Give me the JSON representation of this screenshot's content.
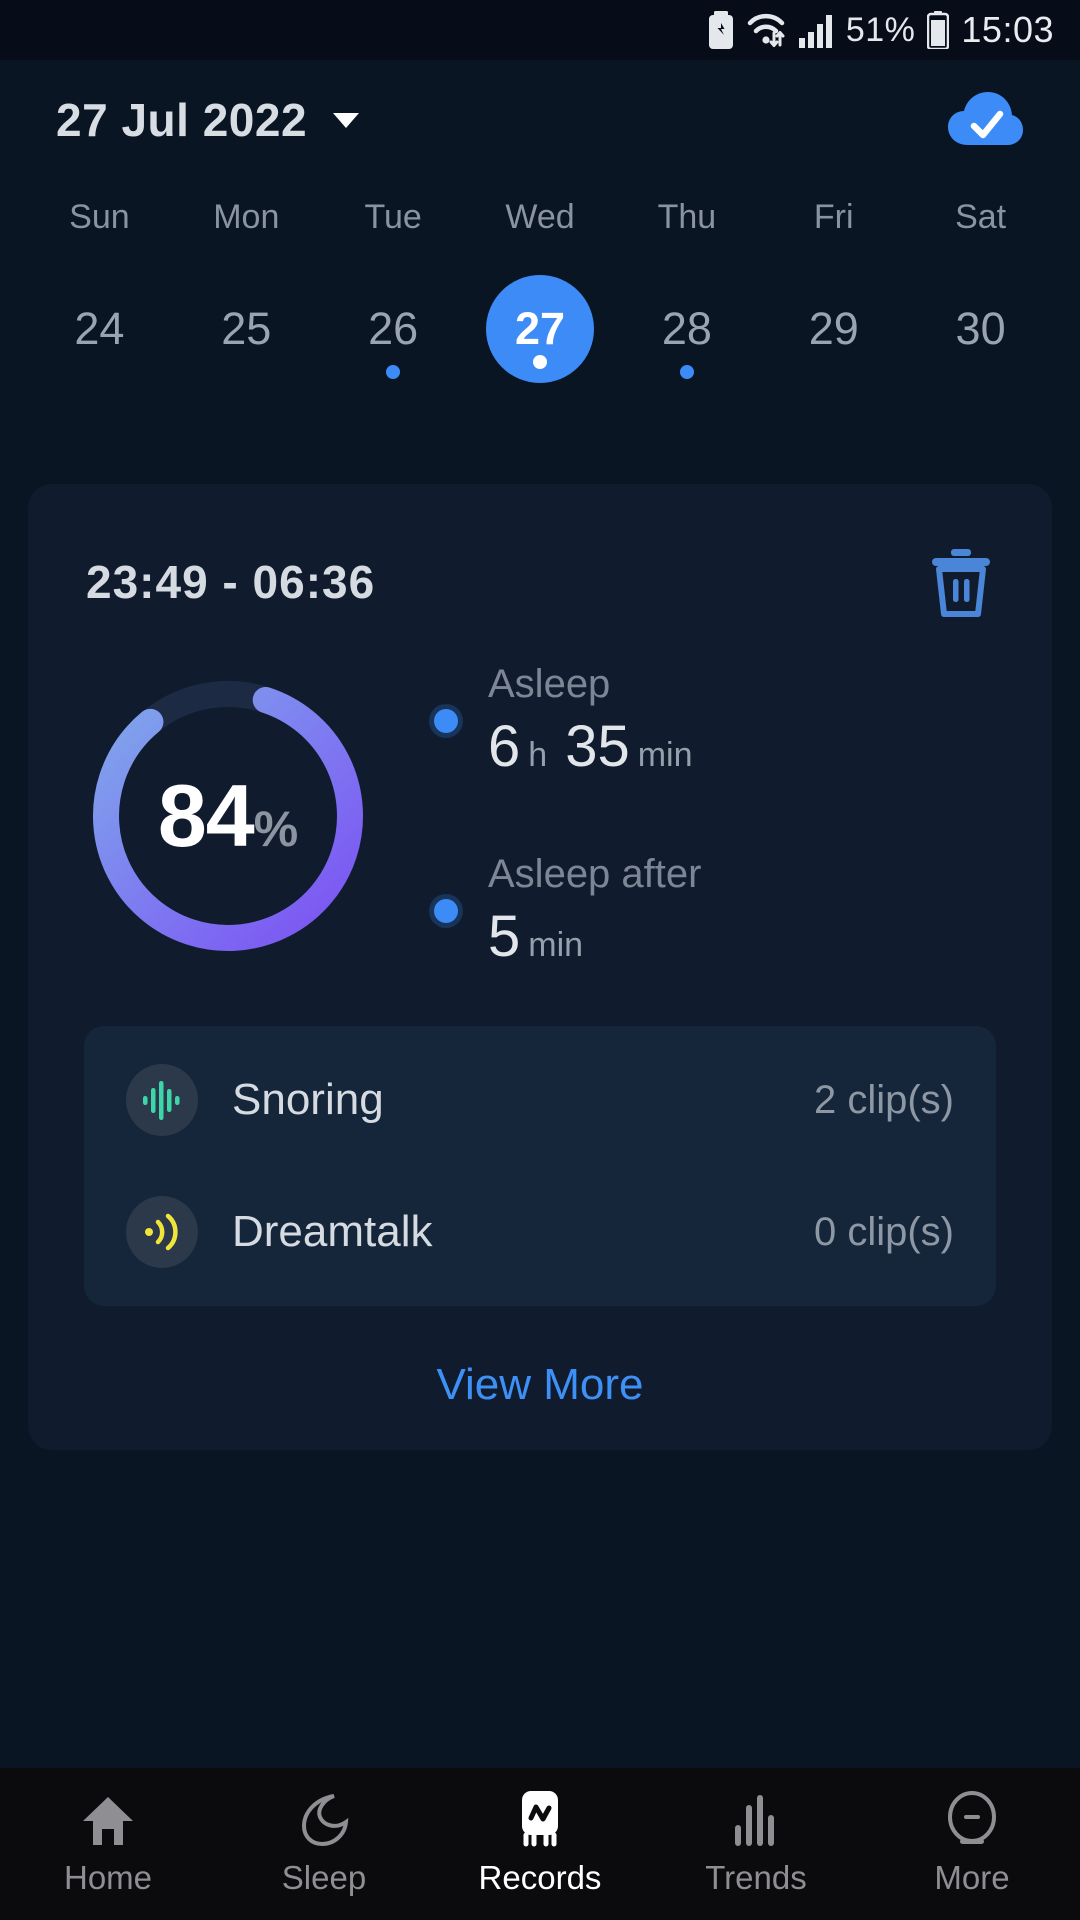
{
  "status_bar": {
    "battery_saver_icon": "battery-saver-icon",
    "wifi_icon": "wifi-icon",
    "signal_icon": "signal-bars-icon",
    "battery_percent": "51%",
    "battery_icon": "battery-icon",
    "time": "15:03"
  },
  "header": {
    "date": "27 Jul 2022",
    "dropdown_icon": "chevron-down-icon",
    "cloud_sync_icon": "cloud-check-icon"
  },
  "calendar": {
    "weekday_labels": [
      "Sun",
      "Mon",
      "Tue",
      "Wed",
      "Thu",
      "Fri",
      "Sat"
    ],
    "days": [
      {
        "num": "24",
        "selected": false,
        "has_record": false
      },
      {
        "num": "25",
        "selected": false,
        "has_record": false
      },
      {
        "num": "26",
        "selected": false,
        "has_record": true
      },
      {
        "num": "27",
        "selected": true,
        "has_record": true
      },
      {
        "num": "28",
        "selected": false,
        "has_record": true
      },
      {
        "num": "29",
        "selected": false,
        "has_record": false
      },
      {
        "num": "30",
        "selected": false,
        "has_record": false
      }
    ]
  },
  "record_card": {
    "time_range": "23:49 - 06:36",
    "delete_icon": "trash-icon",
    "ring": {
      "value": "84",
      "unit": "%",
      "percent": 84,
      "track_color": "#1C2B43",
      "gradient_start": "#7FA0EC",
      "gradient_end": "#7C58F2"
    },
    "stats": [
      {
        "label": "Asleep",
        "parts": [
          {
            "num": "6",
            "unit": "h"
          },
          {
            "num": "35",
            "unit": "min"
          }
        ]
      },
      {
        "label": "Asleep after",
        "parts": [
          {
            "num": "5",
            "unit": "min"
          }
        ]
      }
    ],
    "sounds": [
      {
        "icon": "waveform-icon",
        "icon_color": "#3DD6A8",
        "name": "Snoring",
        "count": "2 clip(s)"
      },
      {
        "icon": "sound-wave-icon",
        "icon_color": "#F2E53A",
        "name": "Dreamtalk",
        "count": "0 clip(s)"
      }
    ],
    "view_more_label": "View More",
    "view_more_color": "#3D90F5"
  },
  "bottom_nav": {
    "items": [
      {
        "label": "Home",
        "icon": "home-icon",
        "active": false
      },
      {
        "label": "Sleep",
        "icon": "moon-icon",
        "active": false
      },
      {
        "label": "Records",
        "icon": "records-pulse-icon",
        "active": true
      },
      {
        "label": "Trends",
        "icon": "bar-chart-icon",
        "active": false
      },
      {
        "label": "More",
        "icon": "more-face-icon",
        "active": false
      }
    ]
  }
}
